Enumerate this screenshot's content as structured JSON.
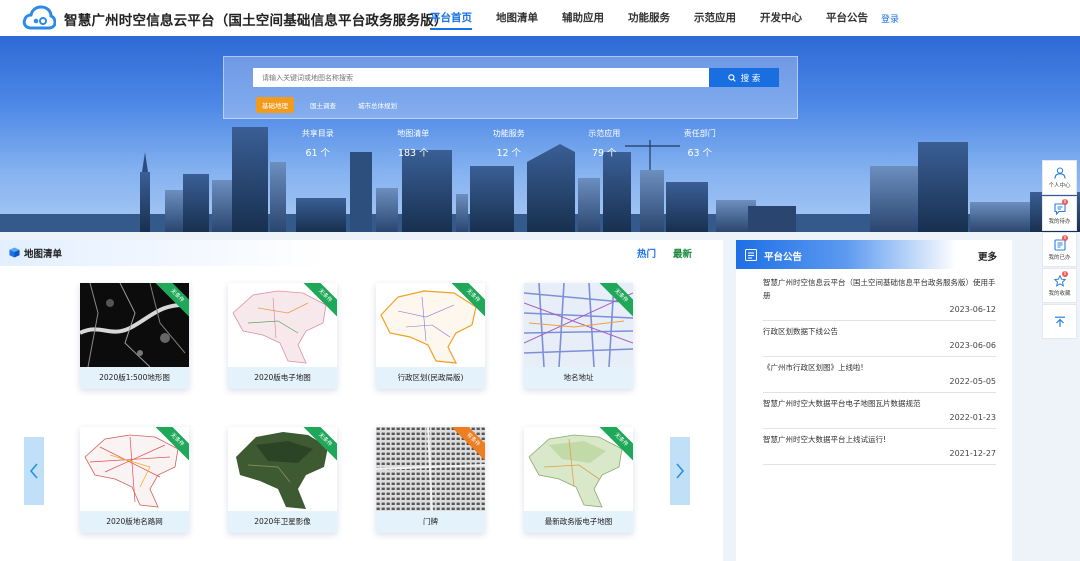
{
  "header": {
    "title": "智慧广州时空信息云平台（国土空间基础信息平台政务服务版）",
    "nav": [
      {
        "label": "平台首页",
        "active": true
      },
      {
        "label": "地图清单",
        "active": false
      },
      {
        "label": "辅助应用",
        "active": false
      },
      {
        "label": "功能服务",
        "active": false
      },
      {
        "label": "示范应用",
        "active": false
      },
      {
        "label": "开发中心",
        "active": false
      },
      {
        "label": "平台公告",
        "active": false
      }
    ],
    "login_label": "登录"
  },
  "search": {
    "placeholder": "请输入关键词或地图名称搜索",
    "button_label": "搜 索",
    "tags": [
      {
        "label": "基础地理",
        "active": true
      },
      {
        "label": "国土调查",
        "active": false
      },
      {
        "label": "城市总体规划",
        "active": false
      }
    ]
  },
  "stats": [
    {
      "label": "共享目录",
      "value": "61 个"
    },
    {
      "label": "地图清单",
      "value": "183 个"
    },
    {
      "label": "功能服务",
      "value": "12 个"
    },
    {
      "label": "示范应用",
      "value": "79 个"
    },
    {
      "label": "责任部门",
      "value": "63 个"
    }
  ],
  "map_list": {
    "title": "地图清单",
    "tab_hot": "热门",
    "tab_new": "最新",
    "cards": [
      {
        "label": "2020版1:500地形图",
        "ribbon": "无条件",
        "ribbon_color": "#20a85a",
        "thumb": "terrain-bw"
      },
      {
        "label": "2020版电子地图",
        "ribbon": "无条件",
        "ribbon_color": "#20a85a",
        "thumb": "electronic-map"
      },
      {
        "label": "行政区划(民政局版)",
        "ribbon": "无条件",
        "ribbon_color": "#20a85a",
        "thumb": "admin-divisions"
      },
      {
        "label": "地名地址",
        "ribbon": "无条件",
        "ribbon_color": "#20a85a",
        "thumb": "place-names"
      },
      {
        "label": "2020版地名路网",
        "ribbon": "无条件",
        "ribbon_color": "#20a85a",
        "thumb": "road-network"
      },
      {
        "label": "2020年卫星影像",
        "ribbon": "无条件",
        "ribbon_color": "#20a85a",
        "thumb": "satellite"
      },
      {
        "label": "门牌",
        "ribbon": "有条件",
        "ribbon_color": "#ef7d22",
        "thumb": "door-plates"
      },
      {
        "label": "最新政务版电子地图",
        "ribbon": "无条件",
        "ribbon_color": "#20a85a",
        "thumb": "gov-map"
      }
    ]
  },
  "notices": {
    "title": "平台公告",
    "more_label": "更多",
    "items": [
      {
        "text": "智慧广州时空信息云平台（国土空间基础信息平台政务服务版）使用手册",
        "date": "2023-06-12"
      },
      {
        "text": "行政区划数据下线公告",
        "date": "2023-06-06"
      },
      {
        "text": "《广州市行政区划图》上线啦!",
        "date": "2022-05-05"
      },
      {
        "text": "智慧广州时空大数据平台电子地图瓦片数据规范",
        "date": "2022-01-23"
      },
      {
        "text": "智慧广州时空大数据平台上线试运行!",
        "date": "2021-12-27"
      }
    ]
  },
  "float_bar": [
    {
      "label": "个人中心",
      "icon": "user-icon",
      "badge": ""
    },
    {
      "label": "我的待办",
      "icon": "todo-icon",
      "badge": "0"
    },
    {
      "label": "我的已办",
      "icon": "done-icon",
      "badge": "0"
    },
    {
      "label": "我的收藏",
      "icon": "star-icon",
      "badge": "0"
    },
    {
      "label": "",
      "icon": "back-to-top-icon",
      "badge": ""
    }
  ]
}
